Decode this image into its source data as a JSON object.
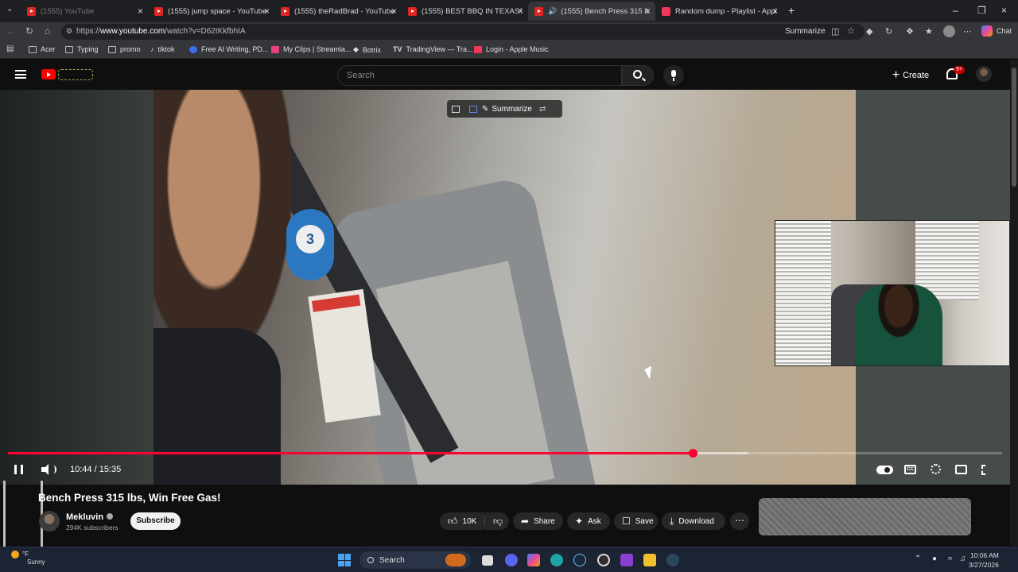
{
  "browser": {
    "tabs": [
      {
        "label": "(1555) YouTube",
        "active": false
      },
      {
        "label": "(1555) jump space - YouTube",
        "active": false
      },
      {
        "label": "(1555) theRadBrad - YouTube",
        "active": false
      },
      {
        "label": "(1555) BEST BBQ IN TEXAS? #shor",
        "active": false
      },
      {
        "label": "(1555) Bench Press 315 lbs, W",
        "active": true
      },
      {
        "label": "Random dump - Playlist - Apple M",
        "active": false
      }
    ],
    "url_prefix": "https://",
    "url_host": "www.youtube.com",
    "url_path": "/watch?v=D62tKkfbhIA",
    "summarize_label": "Summarize",
    "chat_label": "Chat",
    "bookmarks": [
      {
        "label": "Acer",
        "icon": "folder-icon"
      },
      {
        "label": "Typing",
        "icon": "folder-icon"
      },
      {
        "label": "promo",
        "icon": "folder-icon"
      },
      {
        "label": "tiktok",
        "icon": "tiktok-icon"
      },
      {
        "label": "Free AI Writing, PD...",
        "icon": "ai-icon"
      },
      {
        "label": "My Clips | Streamla...",
        "icon": "streamladder-icon"
      },
      {
        "label": "Botrix",
        "icon": "botrix-icon"
      },
      {
        "label": "TradingView — Tra...",
        "icon": "tradingview-icon"
      },
      {
        "label": "Login - Apple Music",
        "icon": "apple-music-icon"
      }
    ]
  },
  "youtube": {
    "search_placeholder": "Search",
    "create_label": "Create",
    "notification_count": "9+",
    "overlay_summarize": "Summarize",
    "video": {
      "current_time": "10:44",
      "duration": "15:35",
      "time_display": "10:44 / 15:35",
      "progress_fraction": 0.689,
      "buffered_fraction": 0.745
    },
    "title": "Bench Press 315 lbs, Win Free Gas!",
    "channel_name": "Mekluvin",
    "subscribers": "294K subscribers",
    "subscribe_label": "Subscribe",
    "likes": "10K",
    "share_label": "Share",
    "ask_label": "Ask",
    "save_label": "Save",
    "download_label": "Download"
  },
  "taskbar": {
    "weather_temp": "°F",
    "weather_text": "Sunny",
    "search_label": "Search",
    "time": "10:06 AM",
    "date": "3/27/2026"
  },
  "colors": {
    "accent": "#ff0033",
    "youtube_red": "#ff0000",
    "background": "#0f0f0f"
  }
}
